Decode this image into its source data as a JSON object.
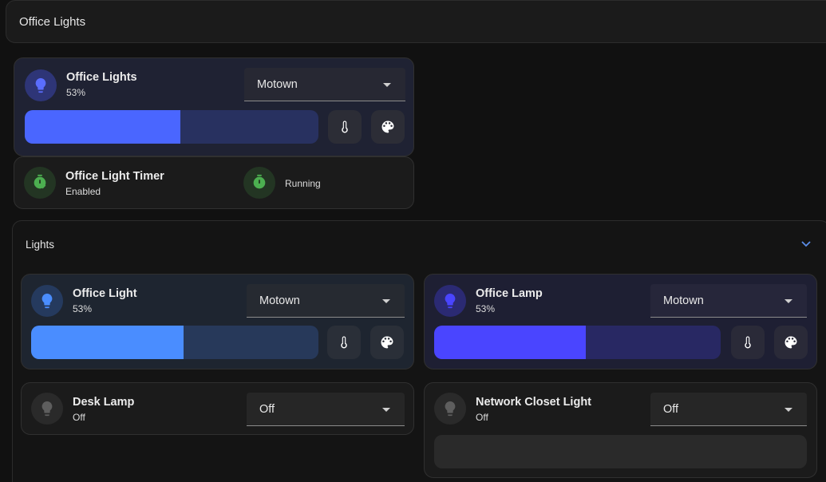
{
  "header": {
    "title": "Office Lights"
  },
  "main_card": {
    "name": "Office Lights",
    "state": "53%",
    "effect": "Motown",
    "brightness_pct": 53,
    "colors": {
      "icon_bg": "#2e3577",
      "icon": "#5a6dff",
      "fill": "#4a66ff",
      "track": "#283160"
    }
  },
  "timer": {
    "name": "Office Light Timer",
    "state": "Enabled",
    "status": "Running",
    "colors": {
      "icon_bg": "#233523",
      "icon": "#4caf50"
    }
  },
  "section": {
    "title": "Lights",
    "cards": [
      {
        "name": "Office Light",
        "state": "53%",
        "effect": "Motown",
        "brightness_pct": 53,
        "colors": {
          "icon_bg": "#253a5e",
          "icon": "#4a8dff",
          "fill": "#4a8dff",
          "track": "#27395a"
        }
      },
      {
        "name": "Office Lamp",
        "state": "53%",
        "effect": "Motown",
        "brightness_pct": 53,
        "colors": {
          "icon_bg": "#2b2a73",
          "icon": "#4a45ff",
          "fill": "#4a45ff",
          "track": "#282863"
        }
      },
      {
        "name": "Desk Lamp",
        "state": "Off",
        "effect": "Off"
      },
      {
        "name": "Network Closet Light",
        "state": "Off",
        "effect": "Off"
      }
    ]
  }
}
